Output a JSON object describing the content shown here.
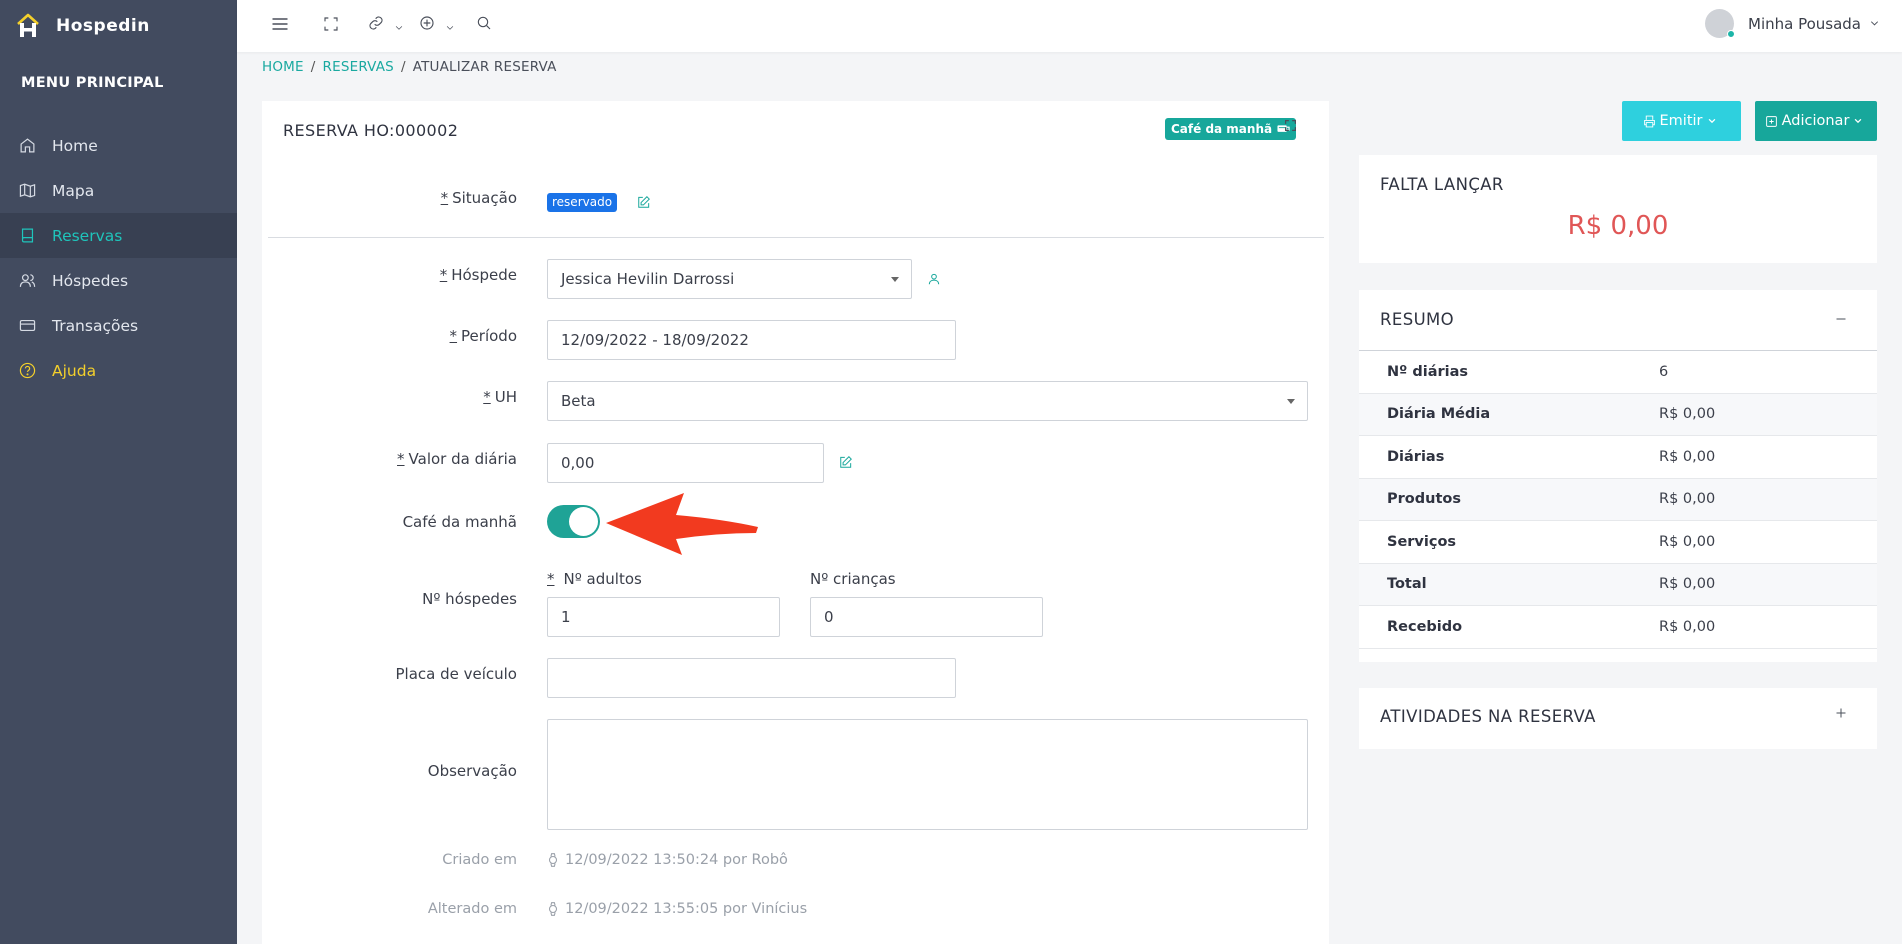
{
  "brand": {
    "name": "Hospedin"
  },
  "sidebar": {
    "section_title": "MENU PRINCIPAL",
    "items": [
      {
        "label": "Home",
        "icon": "home-icon"
      },
      {
        "label": "Mapa",
        "icon": "map-icon"
      },
      {
        "label": "Reservas",
        "icon": "book-icon",
        "active": true
      },
      {
        "label": "Hóspedes",
        "icon": "users-icon"
      },
      {
        "label": "Transações",
        "icon": "credit-card-icon"
      },
      {
        "label": "Ajuda",
        "icon": "help-circle-icon"
      }
    ]
  },
  "topbar": {
    "user_name": "Minha Pousada"
  },
  "breadcrumb": {
    "home": "HOME",
    "reservas": "RESERVAS",
    "current": "ATUALIZAR RESERVA",
    "sep": "/"
  },
  "reservation": {
    "title": "RESERVA HO:000002",
    "cafe_badge": "Café da manhã",
    "required_mark": "*",
    "fields": {
      "situacao_label": "Situação",
      "situacao_value": "reservado",
      "hospede_label": "Hóspede",
      "hospede_value": "Jessica Hevilin Darrossi",
      "periodo_label": "Período",
      "periodo_value": "12/09/2022 - 18/09/2022",
      "uh_label": "UH",
      "uh_value": "Beta",
      "valor_label": "Valor da diária",
      "valor_value": "0,00",
      "cafe_label": "Café da manhã",
      "cafe_on": true,
      "hospedes_label": "Nº hóspedes",
      "adultos_label": "Nº adultos",
      "adultos_value": "1",
      "criancas_label": "Nº crianças",
      "criancas_value": "0",
      "placa_label": "Placa de veículo",
      "placa_value": "",
      "obs_label": "Observação",
      "obs_value": "",
      "criado_label": "Criado em",
      "criado_value": "12/09/2022 13:50:24 por Robô",
      "alterado_label": "Alterado em",
      "alterado_value": "12/09/2022 13:55:05 por Vinícius"
    }
  },
  "actions": {
    "emit": "Emitir",
    "add": "Adicionar"
  },
  "falta": {
    "title": "FALTA LANÇAR",
    "value": "R$ 0,00"
  },
  "resumo": {
    "title": "RESUMO",
    "rows": [
      {
        "k": "Nº diárias",
        "v": "6"
      },
      {
        "k": "Diária Média",
        "v": "R$ 0,00"
      },
      {
        "k": "Diárias",
        "v": "R$ 0,00"
      },
      {
        "k": "Produtos",
        "v": "R$ 0,00"
      },
      {
        "k": "Serviços",
        "v": "R$ 0,00"
      },
      {
        "k": "Total",
        "v": "R$ 0,00"
      },
      {
        "k": "Recebido",
        "v": "R$ 0,00"
      }
    ]
  },
  "atividades": {
    "title": "ATIVIDADES NA RESERVA"
  },
  "colors": {
    "sidebar_bg": "#424b5f",
    "accent": "#17a79b",
    "cyan": "#2ed0de",
    "danger": "#e05656",
    "arrow": "#f23a1f"
  }
}
